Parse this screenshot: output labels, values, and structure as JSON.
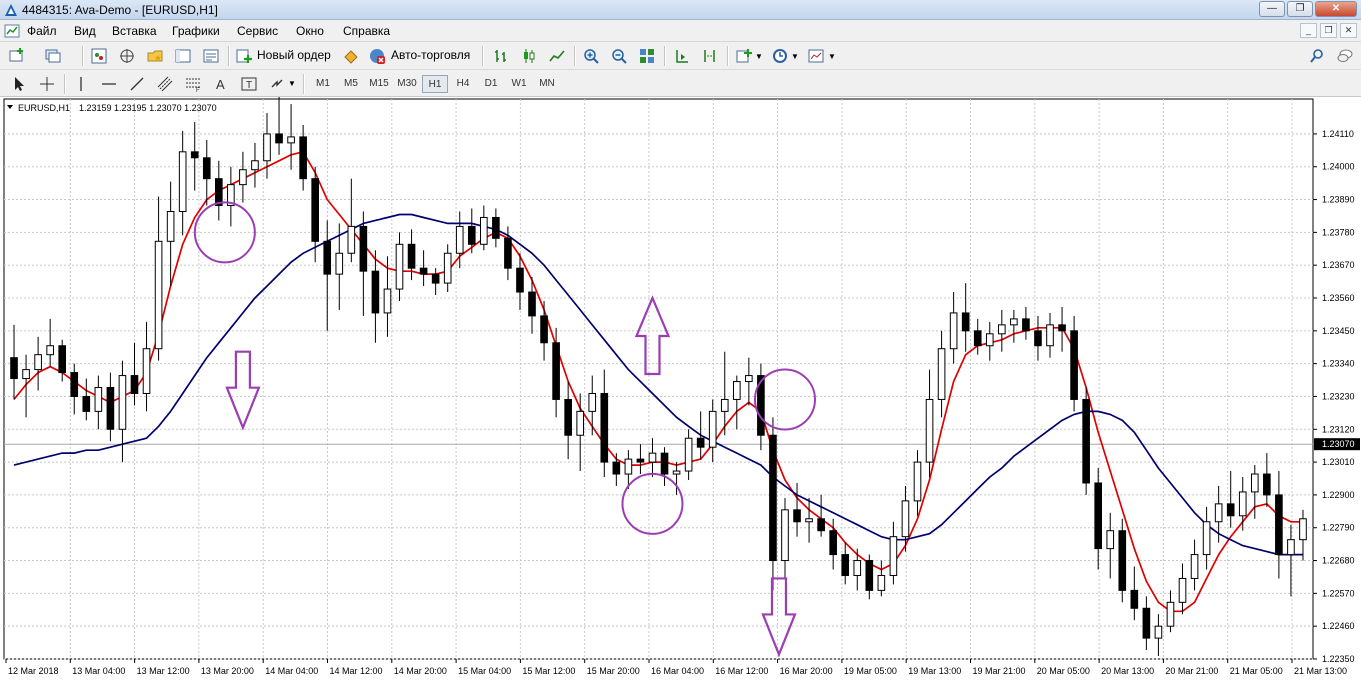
{
  "window": {
    "title": "4484315: Ava-Demo - [EURUSD,H1]",
    "controls": [
      "minimize",
      "restore",
      "close"
    ]
  },
  "menu": {
    "items": [
      "Файл",
      "Вид",
      "Вставка",
      "Графики",
      "Сервис",
      "Окно",
      "Справка"
    ]
  },
  "toolbar": {
    "new_order_label": "Новый ордер",
    "auto_trading_label": "Авто-торговля",
    "timeframes": [
      "M1",
      "M5",
      "M15",
      "M30",
      "H1",
      "H4",
      "D1",
      "W1",
      "MN"
    ],
    "active_timeframe": "H1"
  },
  "colors": {
    "bull_candle": "#ffffff",
    "bear_candle": "#000000",
    "fast_ma": "#e00000",
    "slow_ma": "#00006e",
    "annotation": "#9b3db3",
    "price_marker_bg": "#000000"
  },
  "chart_data": {
    "type": "candlestick",
    "symbol_label": "EURUSD,H1",
    "ohlc_label": "1.23159 1.23195 1.23070 1.23070",
    "current_price_label": "1.23070",
    "current_price": 1.2307,
    "ylim": [
      1.2235,
      1.2416
    ],
    "y_ticks": [
      "1.24110",
      "1.24000",
      "1.23890",
      "1.23780",
      "1.23670",
      "1.23560",
      "1.23450",
      "1.23340",
      "1.23230",
      "1.23120",
      "1.23010",
      "1.22900",
      "1.22790",
      "1.22680",
      "1.22570",
      "1.22460",
      "1.22350"
    ],
    "x_ticks": [
      "12 Mar 2018",
      "13 Mar 04:00",
      "13 Mar 12:00",
      "13 Mar 20:00",
      "14 Mar 04:00",
      "14 Mar 12:00",
      "14 Mar 20:00",
      "15 Mar 04:00",
      "15 Mar 12:00",
      "15 Mar 20:00",
      "16 Mar 04:00",
      "16 Mar 12:00",
      "16 Mar 20:00",
      "19 Mar 05:00",
      "19 Mar 13:00",
      "19 Mar 21:00",
      "20 Mar 05:00",
      "20 Mar 13:00",
      "20 Mar 21:00",
      "21 Mar 05:00",
      "21 Mar 13:00"
    ],
    "candles": [
      [
        1.2336,
        1.2347,
        1.2322,
        1.2329
      ],
      [
        1.2329,
        1.2337,
        1.2316,
        1.2332
      ],
      [
        1.2332,
        1.2343,
        1.2325,
        1.2337
      ],
      [
        1.2337,
        1.2349,
        1.2333,
        1.234
      ],
      [
        1.234,
        1.2342,
        1.2328,
        1.2331
      ],
      [
        1.2331,
        1.2334,
        1.2317,
        1.2323
      ],
      [
        1.2323,
        1.2329,
        1.2315,
        1.2318
      ],
      [
        1.2318,
        1.233,
        1.2312,
        1.2326
      ],
      [
        1.2326,
        1.2331,
        1.2308,
        1.2312
      ],
      [
        1.2312,
        1.2335,
        1.2301,
        1.233
      ],
      [
        1.233,
        1.2341,
        1.232,
        1.2324
      ],
      [
        1.2324,
        1.2348,
        1.2318,
        1.2339
      ],
      [
        1.2339,
        1.239,
        1.2335,
        1.2375
      ],
      [
        1.2375,
        1.2395,
        1.236,
        1.2385
      ],
      [
        1.2385,
        1.2412,
        1.2377,
        1.2405
      ],
      [
        1.2405,
        1.2415,
        1.2392,
        1.2403
      ],
      [
        1.2403,
        1.2409,
        1.2387,
        1.2396
      ],
      [
        1.2396,
        1.2402,
        1.2382,
        1.2387
      ],
      [
        1.2387,
        1.24,
        1.238,
        1.2394
      ],
      [
        1.2394,
        1.2405,
        1.2388,
        1.2399
      ],
      [
        1.2399,
        1.2408,
        1.2393,
        1.2402
      ],
      [
        1.2402,
        1.2418,
        1.2396,
        1.2411
      ],
      [
        1.2411,
        1.2425,
        1.2404,
        1.2408
      ],
      [
        1.2408,
        1.2421,
        1.2399,
        1.241
      ],
      [
        1.241,
        1.2414,
        1.2392,
        1.2396
      ],
      [
        1.2396,
        1.24,
        1.2368,
        1.2375
      ],
      [
        1.2375,
        1.2382,
        1.2345,
        1.2364
      ],
      [
        1.2364,
        1.2381,
        1.2352,
        1.2371
      ],
      [
        1.2371,
        1.2396,
        1.2368,
        1.238
      ],
      [
        1.238,
        1.2385,
        1.235,
        1.2365
      ],
      [
        1.2365,
        1.2372,
        1.2341,
        1.2351
      ],
      [
        1.2351,
        1.237,
        1.2343,
        1.2359
      ],
      [
        1.2359,
        1.2378,
        1.2355,
        1.2374
      ],
      [
        1.2374,
        1.2379,
        1.2362,
        1.2366
      ],
      [
        1.2366,
        1.2372,
        1.236,
        1.2364
      ],
      [
        1.2364,
        1.2366,
        1.2357,
        1.2361
      ],
      [
        1.2361,
        1.2374,
        1.2358,
        1.2371
      ],
      [
        1.2371,
        1.2385,
        1.2366,
        1.238
      ],
      [
        1.238,
        1.2386,
        1.2371,
        1.2374
      ],
      [
        1.2374,
        1.2387,
        1.2372,
        1.2383
      ],
      [
        1.2383,
        1.2386,
        1.2373,
        1.2376
      ],
      [
        1.2376,
        1.238,
        1.2362,
        1.2366
      ],
      [
        1.2366,
        1.2371,
        1.2352,
        1.2358
      ],
      [
        1.2358,
        1.2363,
        1.2344,
        1.235
      ],
      [
        1.235,
        1.2355,
        1.2335,
        1.2341
      ],
      [
        1.2341,
        1.2346,
        1.2316,
        1.2322
      ],
      [
        1.2322,
        1.2328,
        1.2302,
        1.231
      ],
      [
        1.231,
        1.2324,
        1.2298,
        1.2318
      ],
      [
        1.2318,
        1.233,
        1.231,
        1.2324
      ],
      [
        1.2324,
        1.2332,
        1.2296,
        1.2301
      ],
      [
        1.2301,
        1.2304,
        1.2293,
        1.2297
      ],
      [
        1.2297,
        1.2305,
        1.2292,
        1.2302
      ],
      [
        1.2302,
        1.2307,
        1.2297,
        1.2301
      ],
      [
        1.2301,
        1.2309,
        1.2296,
        1.2304
      ],
      [
        1.2304,
        1.2306,
        1.2293,
        1.2297
      ],
      [
        1.2297,
        1.2301,
        1.229,
        1.2298
      ],
      [
        1.2298,
        1.2312,
        1.2295,
        1.2309
      ],
      [
        1.2309,
        1.2318,
        1.2302,
        1.2306
      ],
      [
        1.2306,
        1.2322,
        1.2301,
        1.2318
      ],
      [
        1.2318,
        1.2338,
        1.231,
        1.2322
      ],
      [
        1.2322,
        1.233,
        1.2312,
        1.2328
      ],
      [
        1.2328,
        1.2336,
        1.232,
        1.233
      ],
      [
        1.233,
        1.2334,
        1.2305,
        1.231
      ],
      [
        1.231,
        1.2316,
        1.2258,
        1.2268
      ],
      [
        1.2268,
        1.2289,
        1.2262,
        1.2285
      ],
      [
        1.2285,
        1.2294,
        1.2276,
        1.2281
      ],
      [
        1.2281,
        1.2289,
        1.2274,
        1.2282
      ],
      [
        1.2282,
        1.229,
        1.2276,
        1.2278
      ],
      [
        1.2278,
        1.2282,
        1.2265,
        1.227
      ],
      [
        1.227,
        1.2274,
        1.226,
        1.2263
      ],
      [
        1.2263,
        1.2272,
        1.2258,
        1.2268
      ],
      [
        1.2268,
        1.227,
        1.2255,
        1.2258
      ],
      [
        1.2258,
        1.2268,
        1.2256,
        1.2263
      ],
      [
        1.2263,
        1.2281,
        1.226,
        1.2276
      ],
      [
        1.2276,
        1.2293,
        1.2271,
        1.2288
      ],
      [
        1.2288,
        1.2305,
        1.2283,
        1.2301
      ],
      [
        1.2301,
        1.2332,
        1.2296,
        1.2322
      ],
      [
        1.2322,
        1.2345,
        1.2316,
        1.2339
      ],
      [
        1.2339,
        1.2358,
        1.2334,
        1.2351
      ],
      [
        1.2351,
        1.2361,
        1.2338,
        1.2345
      ],
      [
        1.2345,
        1.2349,
        1.2337,
        1.234
      ],
      [
        1.234,
        1.2348,
        1.2335,
        1.2344
      ],
      [
        1.2344,
        1.2352,
        1.2338,
        1.2347
      ],
      [
        1.2347,
        1.2352,
        1.2341,
        1.2349
      ],
      [
        1.2349,
        1.2353,
        1.2342,
        1.2345
      ],
      [
        1.2345,
        1.235,
        1.2335,
        1.234
      ],
      [
        1.234,
        1.2351,
        1.2336,
        1.2347
      ],
      [
        1.2347,
        1.2353,
        1.2338,
        1.2345
      ],
      [
        1.2345,
        1.235,
        1.2318,
        1.2322
      ],
      [
        1.2322,
        1.2326,
        1.229,
        1.2294
      ],
      [
        1.2294,
        1.2299,
        1.2265,
        1.2272
      ],
      [
        1.2272,
        1.2284,
        1.2262,
        1.2278
      ],
      [
        1.2278,
        1.2282,
        1.2254,
        1.2258
      ],
      [
        1.2258,
        1.2266,
        1.2248,
        1.2252
      ],
      [
        1.2252,
        1.2256,
        1.2238,
        1.2242
      ],
      [
        1.2242,
        1.225,
        1.2236,
        1.2246
      ],
      [
        1.2246,
        1.2258,
        1.2244,
        1.2254
      ],
      [
        1.2254,
        1.2267,
        1.225,
        1.2262
      ],
      [
        1.2262,
        1.2275,
        1.2258,
        1.227
      ],
      [
        1.227,
        1.2286,
        1.2265,
        1.2281
      ],
      [
        1.2281,
        1.2293,
        1.2274,
        1.2287
      ],
      [
        1.2287,
        1.2298,
        1.2279,
        1.2283
      ],
      [
        1.2283,
        1.2296,
        1.2278,
        1.2291
      ],
      [
        1.2291,
        1.23,
        1.2282,
        1.2297
      ],
      [
        1.2297,
        1.2304,
        1.2286,
        1.229
      ],
      [
        1.229,
        1.2298,
        1.2262,
        1.227
      ],
      [
        1.227,
        1.228,
        1.2256,
        1.2275
      ],
      [
        1.2275,
        1.2285,
        1.2268,
        1.2282
      ]
    ],
    "series": [
      {
        "color": "#e00000",
        "values": [
          1.2322,
          1.2327,
          1.2331,
          1.2333,
          1.2331,
          1.2328,
          1.2325,
          1.2323,
          1.2321,
          1.2323,
          1.2325,
          1.2331,
          1.2344,
          1.236,
          1.2374,
          1.2383,
          1.2389,
          1.2392,
          1.2394,
          1.2396,
          1.2398,
          1.24,
          1.2402,
          1.2404,
          1.2405,
          1.2398,
          1.2389,
          1.2384,
          1.2379,
          1.2374,
          1.2369,
          1.2366,
          1.2365,
          1.2365,
          1.2364,
          1.2364,
          1.2365,
          1.237,
          1.2373,
          1.2376,
          1.2378,
          1.2376,
          1.237,
          1.2362,
          1.2352,
          1.234,
          1.2328,
          1.2319,
          1.2313,
          1.2307,
          1.2302,
          1.23,
          1.23,
          1.2301,
          1.2301,
          1.23,
          1.2301,
          1.2302,
          1.2307,
          1.2313,
          1.2318,
          1.2321,
          1.2318,
          1.2305,
          1.2295,
          1.2289,
          1.2285,
          1.2282,
          1.2279,
          1.2274,
          1.227,
          1.2267,
          1.2265,
          1.2267,
          1.2273,
          1.2282,
          1.2295,
          1.2312,
          1.2328,
          1.2337,
          1.234,
          1.2341,
          1.2342,
          1.2344,
          1.2345,
          1.2346,
          1.2346,
          1.2346,
          1.2339,
          1.2326,
          1.2311,
          1.2298,
          1.2285,
          1.2272,
          1.2261,
          1.2254,
          1.2251,
          1.2251,
          1.2254,
          1.2262,
          1.227,
          1.2276,
          1.2281,
          1.2286,
          1.2287,
          1.2283,
          1.2281,
          1.2281
        ]
      },
      {
        "color": "#00006e",
        "values": [
          1.23,
          1.2301,
          1.2302,
          1.2303,
          1.2304,
          1.2304,
          1.2305,
          1.2305,
          1.2306,
          1.2307,
          1.2308,
          1.2309,
          1.2313,
          1.2318,
          1.2324,
          1.233,
          1.2336,
          1.2341,
          1.2346,
          1.2351,
          1.2356,
          1.236,
          1.2364,
          1.2368,
          1.2371,
          1.2373,
          1.2375,
          1.2377,
          1.2379,
          1.2381,
          1.2382,
          1.2383,
          1.2384,
          1.2384,
          1.2383,
          1.2382,
          1.2381,
          1.2381,
          1.2381,
          1.238,
          1.2379,
          1.2377,
          1.2374,
          1.2371,
          1.2367,
          1.2362,
          1.2357,
          1.2352,
          1.2347,
          1.2342,
          1.2337,
          1.2332,
          1.2328,
          1.2324,
          1.232,
          1.2316,
          1.2313,
          1.231,
          1.2308,
          1.2306,
          1.2304,
          1.2302,
          1.23,
          1.2296,
          1.2293,
          1.229,
          1.2288,
          1.2286,
          1.2284,
          1.2282,
          1.228,
          1.2278,
          1.2276,
          1.2275,
          1.2275,
          1.2276,
          1.2277,
          1.228,
          1.2284,
          1.2288,
          1.2292,
          1.2296,
          1.2299,
          1.2303,
          1.2306,
          1.2309,
          1.2312,
          1.2315,
          1.2317,
          1.2318,
          1.2318,
          1.2317,
          1.2315,
          1.2311,
          1.2305,
          1.2299,
          1.2294,
          1.2289,
          1.2284,
          1.228,
          1.2277,
          1.2275,
          1.2273,
          1.2272,
          1.2271,
          1.227,
          1.227,
          1.227
        ]
      }
    ],
    "annotations": [
      {
        "shape": "circle",
        "at": [
          17.5,
          1.2378
        ]
      },
      {
        "shape": "arrow-down",
        "at": [
          19,
          1.2338
        ]
      },
      {
        "shape": "arrow-up",
        "at": [
          53,
          1.2356
        ]
      },
      {
        "shape": "circle",
        "at": [
          53,
          1.2287
        ]
      },
      {
        "shape": "circle",
        "at": [
          64,
          1.2322
        ]
      },
      {
        "shape": "arrow-down",
        "at": [
          63.5,
          1.2262
        ]
      }
    ]
  }
}
